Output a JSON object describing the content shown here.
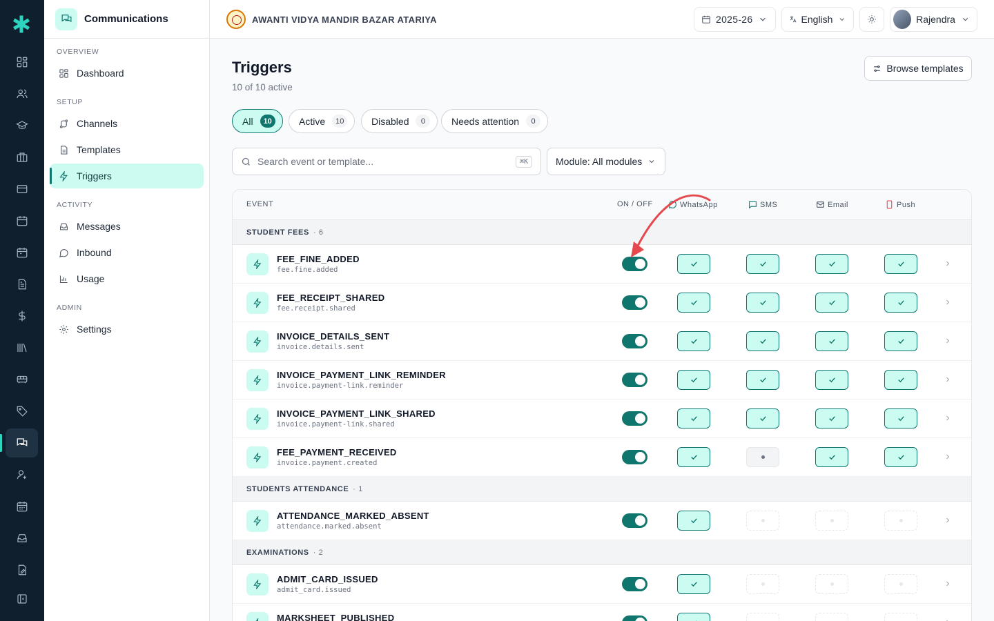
{
  "sidebar": {
    "title": "Communications",
    "sections": [
      {
        "label": "OVERVIEW",
        "items": [
          {
            "label": "Dashboard",
            "icon": "grid-icon"
          }
        ]
      },
      {
        "label": "SETUP",
        "items": [
          {
            "label": "Channels",
            "icon": "route-icon"
          },
          {
            "label": "Templates",
            "icon": "file-text-icon"
          },
          {
            "label": "Triggers",
            "icon": "zap-icon",
            "active": true
          }
        ]
      },
      {
        "label": "ACTIVITY",
        "items": [
          {
            "label": "Messages",
            "icon": "inbox-icon"
          },
          {
            "label": "Inbound",
            "icon": "message-circle-icon"
          },
          {
            "label": "Usage",
            "icon": "bar-chart-icon"
          }
        ]
      },
      {
        "label": "ADMIN",
        "items": [
          {
            "label": "Settings",
            "icon": "gear-icon"
          }
        ]
      }
    ]
  },
  "topbar": {
    "school_name": "AWANTI VIDYA MANDIR BAZAR ATARIYA",
    "year": "2025-26",
    "language": "English",
    "user": "Rajendra"
  },
  "page": {
    "title": "Triggers",
    "subtitle": "10 of 10 active",
    "browse_label": "Browse templates"
  },
  "tabs": [
    {
      "label": "All",
      "count": "10",
      "active": true
    },
    {
      "label": "Active",
      "count": "10"
    },
    {
      "label": "Disabled",
      "count": "0"
    },
    {
      "label": "Needs attention",
      "count": "0"
    }
  ],
  "filters": {
    "search_placeholder": "Search event or template...",
    "search_shortcut": "⌘K",
    "module_label": "Module: All modules"
  },
  "table": {
    "headers": {
      "event": "EVENT",
      "onoff": "ON / OFF",
      "whatsapp": "WhatsApp",
      "sms": "SMS",
      "email": "Email",
      "push": "Push"
    },
    "groups": [
      {
        "label": "STUDENT FEES",
        "count": "· 6",
        "rows": [
          {
            "name": "FEE_FINE_ADDED",
            "key": "fee.fine.added",
            "enabled": true,
            "channels": [
              "on",
              "on",
              "on",
              "on"
            ]
          },
          {
            "name": "FEE_RECEIPT_SHARED",
            "key": "fee.receipt.shared",
            "enabled": true,
            "channels": [
              "on",
              "on",
              "on",
              "on"
            ]
          },
          {
            "name": "INVOICE_DETAILS_SENT",
            "key": "invoice.details.sent",
            "enabled": true,
            "channels": [
              "on",
              "on",
              "on",
              "on"
            ]
          },
          {
            "name": "INVOICE_PAYMENT_LINK_REMINDER",
            "key": "invoice.payment-link.reminder",
            "enabled": true,
            "channels": [
              "on",
              "on",
              "on",
              "on"
            ]
          },
          {
            "name": "INVOICE_PAYMENT_LINK_SHARED",
            "key": "invoice.payment-link.shared",
            "enabled": true,
            "channels": [
              "on",
              "on",
              "on",
              "on"
            ]
          },
          {
            "name": "FEE_PAYMENT_RECEIVED",
            "key": "invoice.payment.created",
            "enabled": true,
            "channels": [
              "on",
              "off",
              "on",
              "on"
            ]
          }
        ]
      },
      {
        "label": "STUDENTS ATTENDANCE",
        "count": "· 1",
        "rows": [
          {
            "name": "ATTENDANCE_MARKED_ABSENT",
            "key": "attendance.marked.absent",
            "enabled": true,
            "channels": [
              "on",
              "na",
              "na",
              "na"
            ]
          }
        ]
      },
      {
        "label": "EXAMINATIONS",
        "count": "· 2",
        "rows": [
          {
            "name": "ADMIT_CARD_ISSUED",
            "key": "admit_card.issued",
            "enabled": true,
            "channels": [
              "on",
              "na",
              "na",
              "na"
            ]
          },
          {
            "name": "MARKSHEET_PUBLISHED",
            "key": "",
            "enabled": true,
            "channels": [
              "on",
              "na",
              "na",
              "na"
            ]
          }
        ]
      }
    ]
  },
  "colors": {
    "accent": "#0f766e",
    "accent_light": "#ccfbf1",
    "rail": "#0f1f2e",
    "arrow": "#e5484d"
  }
}
